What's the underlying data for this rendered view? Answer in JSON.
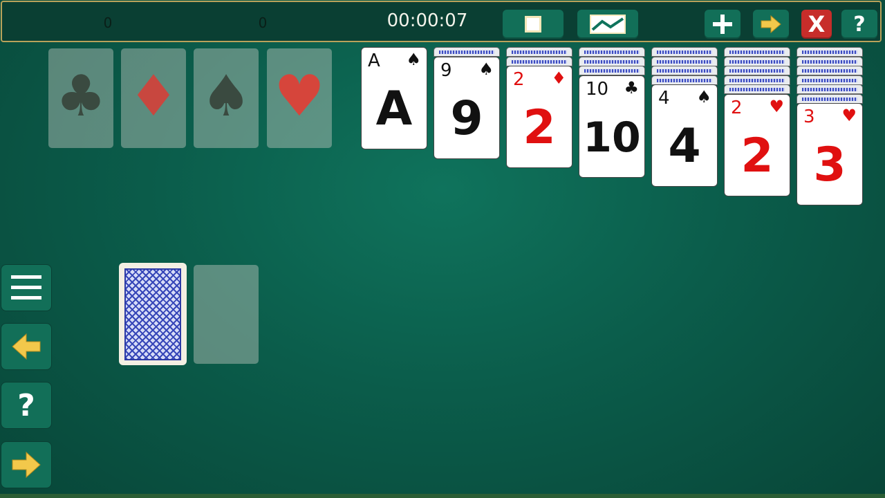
{
  "header": {
    "score_left": "0",
    "score_right": "0",
    "timer": "00:00:07",
    "buttons": [
      "fullscreen",
      "background",
      "new-game",
      "next",
      "close",
      "help"
    ]
  },
  "side_buttons": [
    "menu",
    "undo",
    "hint",
    "auto-move"
  ],
  "foundations": [
    {
      "suit": "♣",
      "color": "#3a4a40"
    },
    {
      "suit": "♦",
      "color": "#c8473f"
    },
    {
      "suit": "♠",
      "color": "#3a4a40"
    },
    {
      "suit": "♥",
      "color": "#d6453b"
    }
  ],
  "tableau": [
    {
      "hidden": 0,
      "rank": "A",
      "suit": "♠",
      "color": "black"
    },
    {
      "hidden": 1,
      "rank": "9",
      "suit": "♠",
      "color": "black"
    },
    {
      "hidden": 2,
      "rank": "2",
      "suit": "♦",
      "color": "red"
    },
    {
      "hidden": 3,
      "rank": "10",
      "suit": "♣",
      "color": "black"
    },
    {
      "hidden": 4,
      "rank": "4",
      "suit": "♠",
      "color": "black"
    },
    {
      "hidden": 5,
      "rank": "2",
      "suit": "♥",
      "color": "red"
    },
    {
      "hidden": 6,
      "rank": "3",
      "suit": "♥",
      "color": "red"
    }
  ],
  "help_glyph": "?",
  "close_glyph": "X"
}
